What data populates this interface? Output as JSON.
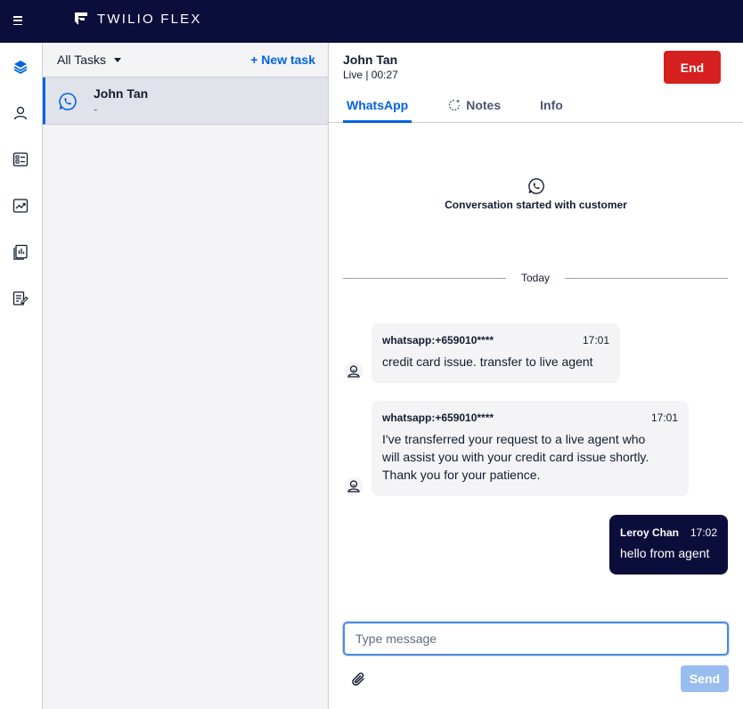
{
  "app": {
    "logo_text": "TWILIO FLEX"
  },
  "nav": {
    "items": [
      {
        "name": "layers-icon",
        "active": true
      },
      {
        "name": "agents-icon"
      },
      {
        "name": "queues-icon"
      },
      {
        "name": "analytics-icon"
      },
      {
        "name": "dashboards-icon"
      },
      {
        "name": "quality-icon"
      }
    ]
  },
  "tasklist": {
    "filter_label": "All Tasks",
    "new_task_label": "+ New task",
    "tasks": [
      {
        "name": "John Tan",
        "subtitle": "-",
        "channel_icon": "whatsapp-icon"
      }
    ]
  },
  "conversation": {
    "customer_name": "John Tan",
    "status": "Live | 00:27",
    "end_label": "End",
    "tabs": [
      {
        "label": "WhatsApp",
        "active": true
      },
      {
        "label": "Notes",
        "icon": "sparkle-icon"
      },
      {
        "label": "Info"
      }
    ],
    "started_text": "Conversation started with customer",
    "divider_label": "Today",
    "messages": [
      {
        "from": "whatsapp:+659010****",
        "time": "17:01",
        "text": "credit card issue. transfer to live agent"
      },
      {
        "from": "whatsapp:+659010****",
        "time": "17:01",
        "lines": [
          "I've transferred your request to a live agent who",
          "will assist you with your credit card issue shortly.",
          "Thank you for your patience."
        ]
      },
      {
        "from": "Leroy Chan",
        "time": "17:02",
        "text": "hello from agent",
        "agent": true
      }
    ],
    "input_placeholder": "Type message",
    "send_label": "Send"
  },
  "colors": {
    "topbar": "#0b0d3a",
    "accent": "#0263e0",
    "end_button": "#d61f1f",
    "agent_bubble": "#0b0d3a",
    "send_disabled": "#99bdef"
  }
}
